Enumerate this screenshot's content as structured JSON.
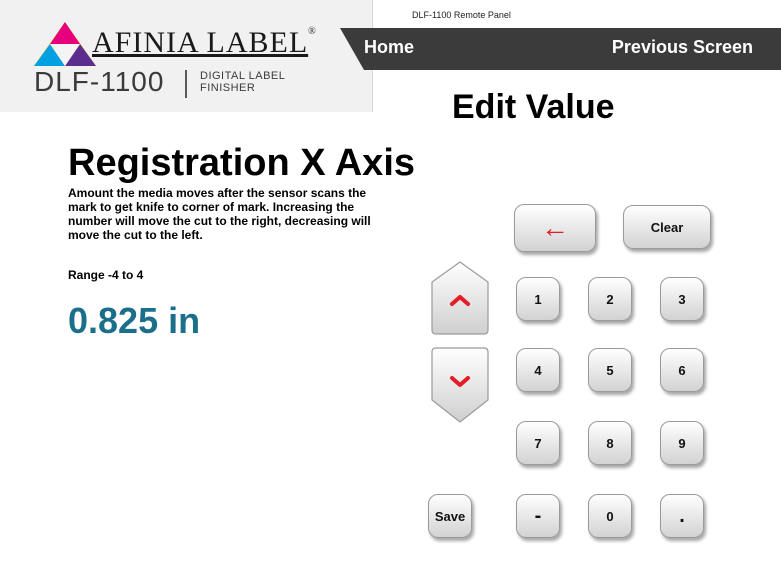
{
  "header": {
    "window_title": "DLF-1100 Remote Panel",
    "logo": {
      "brand": "AFINIA LABEL",
      "model": "DLF-1100",
      "subtitle_line1": "DIGITAL LABEL",
      "subtitle_line2": "FINISHER"
    },
    "nav": {
      "home": "Home",
      "previous": "Previous Screen"
    }
  },
  "page": {
    "title": "Edit Value",
    "setting_name": "Registration X Axis",
    "description": "Amount the media moves after the sensor scans the mark to get knife to corner of mark. Increasing the number will move the cut to the right, decreasing will move the cut to the left.",
    "range": "Range -4 to 4",
    "value": "0.825 in"
  },
  "keypad": {
    "backspace": "←",
    "clear": "Clear",
    "save": "Save",
    "keys": [
      "1",
      "2",
      "3",
      "4",
      "5",
      "6",
      "7",
      "8",
      "9",
      "-",
      "0",
      "."
    ]
  },
  "colors": {
    "value_text": "#1b6f8a",
    "nav_bar": "#3b3b3b",
    "arrow": "#e31d25"
  },
  "icons": {
    "up": "chevron-up-icon",
    "down": "chevron-down-icon",
    "backspace": "backspace-arrow-icon"
  }
}
